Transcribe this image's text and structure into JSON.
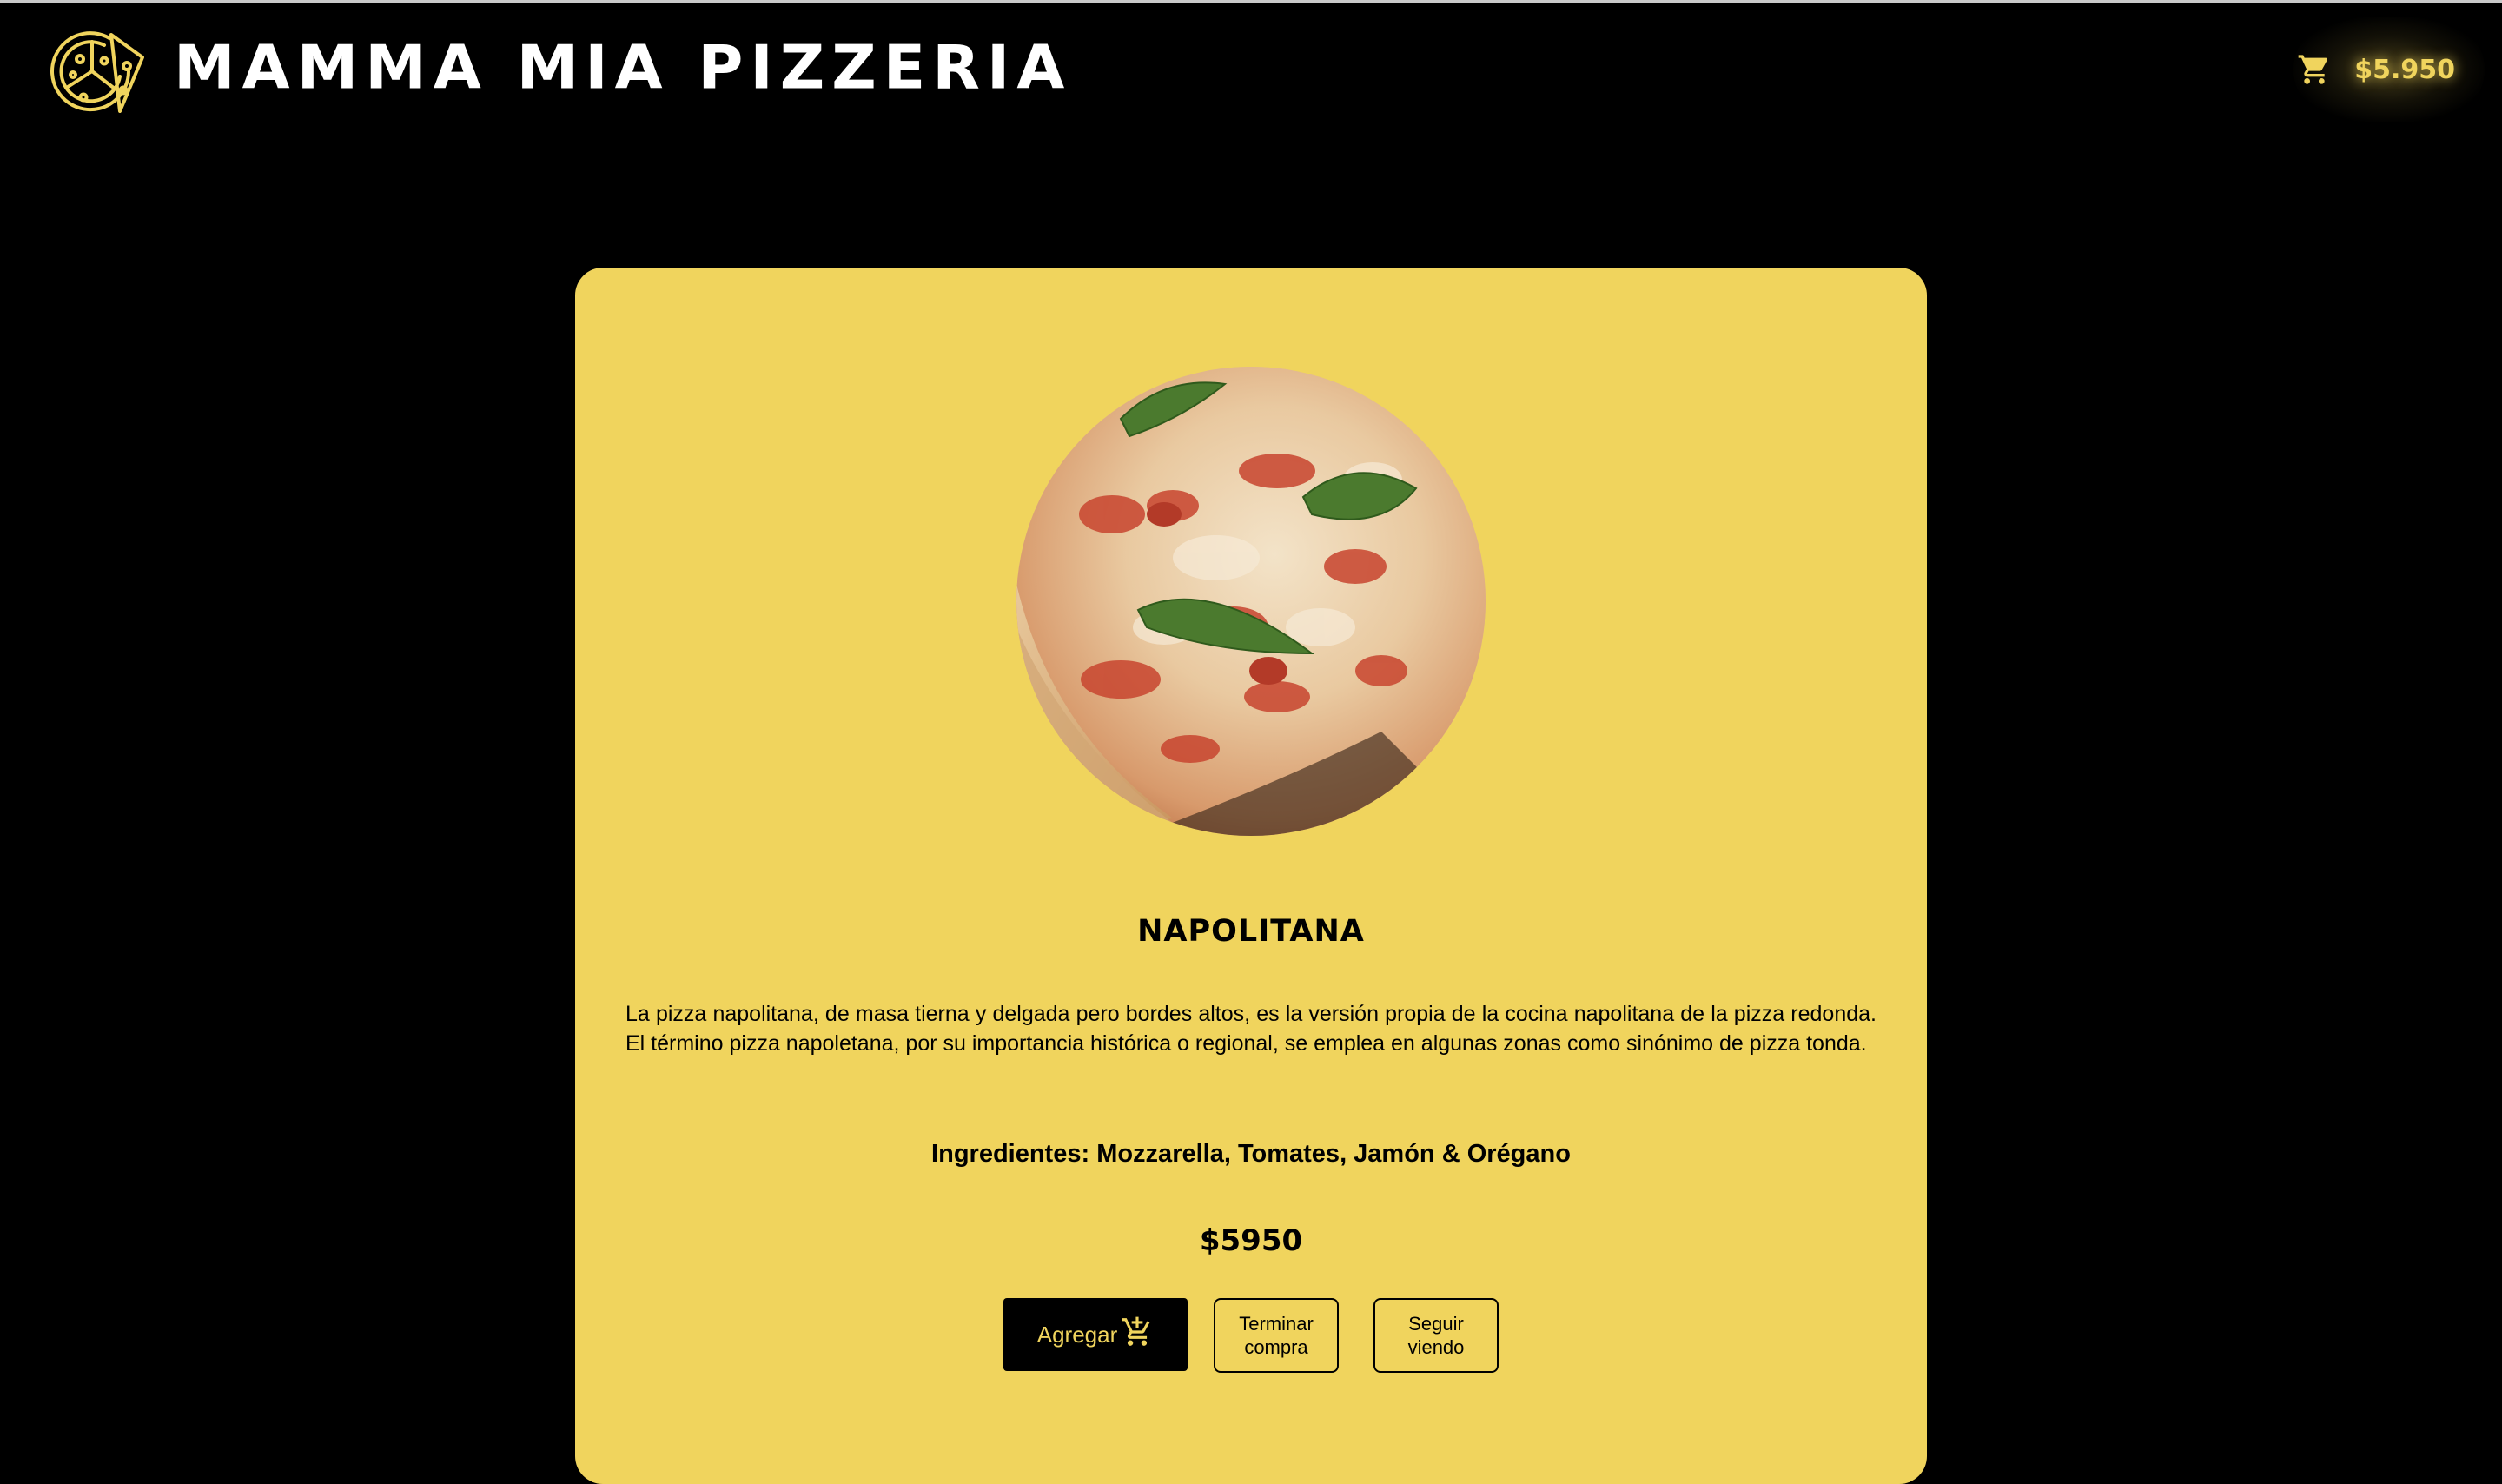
{
  "header": {
    "brand_title": "MAMMA MIA PIZZERIA",
    "logo_icon": "pizza-logo-icon",
    "cart_icon": "shopping-cart-icon",
    "cart_total": "$5.950"
  },
  "product": {
    "image_alt": "pizza-napolitana-photo",
    "name": "NAPOLITANA",
    "description": "La pizza napolitana, de masa tierna y delgada pero bordes altos, es la versión propia de la cocina napolitana de la pizza redonda. El término pizza napoletana, por su importancia histórica o regional, se emplea en algunas zonas como sinónimo de pizza tonda.",
    "ingredients": "Ingredientes: Mozzarella, Tomates, Jamón & Orégano",
    "price": "$5950"
  },
  "actions": {
    "add_label": "Agregar",
    "add_icon": "add-to-cart-icon",
    "finish_label": "Terminar\ncompra",
    "continue_label": "Seguir\nviendo"
  },
  "colors": {
    "background": "#000000",
    "accent": "#f0d45d",
    "title": "#ffffff"
  }
}
